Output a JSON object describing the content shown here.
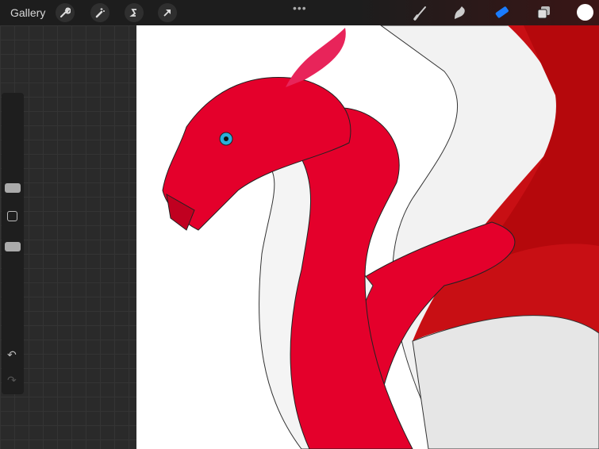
{
  "topbar": {
    "gallery_label": "Gallery",
    "more": "•••"
  },
  "tools": {
    "left": [
      "wrench-icon",
      "magic-wand-icon",
      "selection-icon",
      "transform-arrow-icon"
    ],
    "right": [
      "brush-icon",
      "smudge-icon",
      "eraser-icon",
      "layers-icon",
      "color-swatch"
    ]
  },
  "colors": {
    "active_tool": "#1a7cff",
    "current_color": "#ffffff",
    "dragon_red": "#e4002b"
  },
  "sidebar": {
    "undo": "↶",
    "redo": "↷"
  }
}
